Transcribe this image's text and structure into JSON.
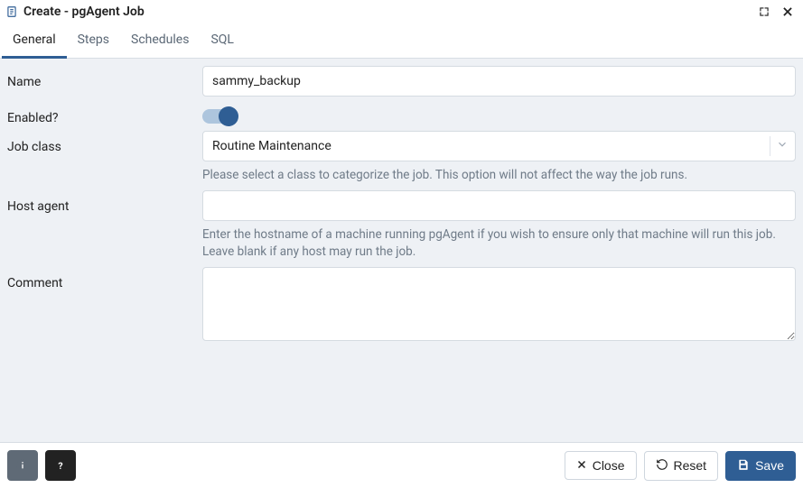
{
  "window": {
    "title": "Create - pgAgent Job"
  },
  "tabs": {
    "general": "General",
    "steps": "Steps",
    "schedules": "Schedules",
    "sql": "SQL"
  },
  "form": {
    "name": {
      "label": "Name",
      "value": "sammy_backup"
    },
    "enabled": {
      "label": "Enabled?",
      "value": true
    },
    "job_class": {
      "label": "Job class",
      "value": "Routine Maintenance",
      "help": "Please select a class to categorize the job. This option will not affect the way the job runs."
    },
    "host_agent": {
      "label": "Host agent",
      "value": "",
      "help": "Enter the hostname of a machine running pgAgent if you wish to ensure only that machine will run this job. Leave blank if any host may run the job."
    },
    "comment": {
      "label": "Comment",
      "value": ""
    }
  },
  "footer": {
    "close": "Close",
    "reset": "Reset",
    "save": "Save"
  }
}
